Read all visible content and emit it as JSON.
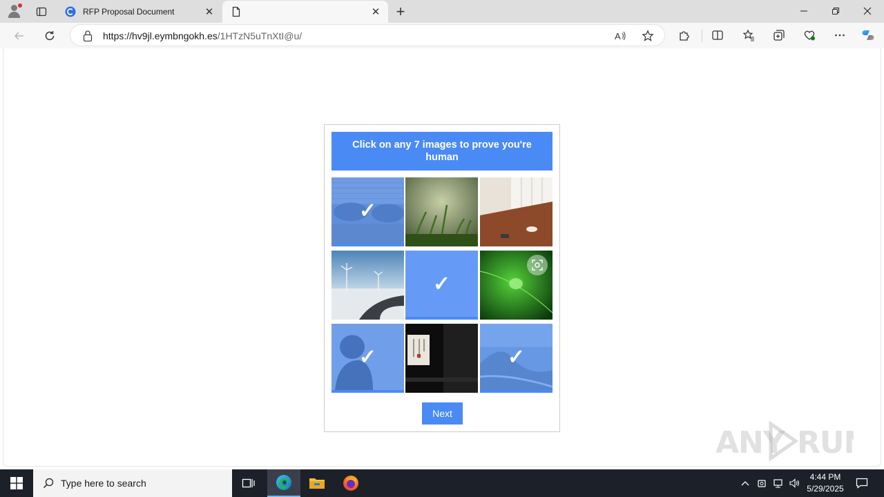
{
  "browser": {
    "tabs": [
      {
        "title": "RFP Proposal Document",
        "active": false
      },
      {
        "title": "",
        "active": true
      }
    ],
    "address": {
      "domain": "https://hv9jl.eymbngokh.es",
      "path": "/1HTzN5uTnXtI@u/"
    }
  },
  "captcha": {
    "instruction": "Click on any 7 images to prove you're human",
    "next_label": "Next",
    "tiles": [
      {
        "name": "vintage-cars",
        "selected": true
      },
      {
        "name": "grass",
        "selected": false
      },
      {
        "name": "cafe-table",
        "selected": false
      },
      {
        "name": "wind-turbines-road",
        "selected": false
      },
      {
        "name": "blank-tile",
        "selected": true
      },
      {
        "name": "green-leaf-water-drop",
        "selected": false
      },
      {
        "name": "person-silhouette",
        "selected": true
      },
      {
        "name": "lantern-dark",
        "selected": false
      },
      {
        "name": "coastline",
        "selected": true
      }
    ],
    "check_mark": "✓"
  },
  "watermark": "ANY.RUN",
  "taskbar": {
    "search_placeholder": "Type here to search",
    "time": "4:44 PM",
    "date": "5/29/2025"
  },
  "colors": {
    "accent": "#4a8af4",
    "taskbar": "#1c2029"
  }
}
